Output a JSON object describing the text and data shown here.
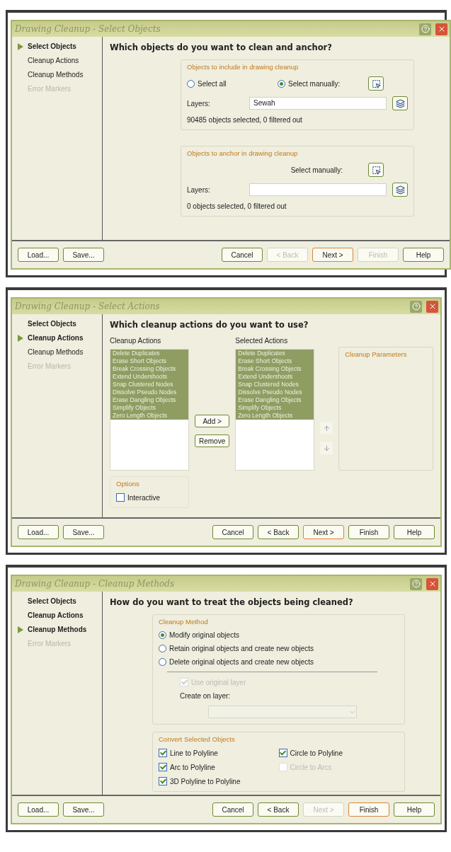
{
  "dialogs": [
    {
      "title": "Drawing Cleanup - Select Objects",
      "steps": [
        {
          "label": "Select Objects",
          "current": true,
          "visited": true,
          "disabled": false
        },
        {
          "label": "Cleanup Actions",
          "current": false,
          "visited": false,
          "disabled": false
        },
        {
          "label": "Cleanup Methods",
          "current": false,
          "visited": false,
          "disabled": false
        },
        {
          "label": "Error Markers",
          "current": false,
          "visited": false,
          "disabled": true
        }
      ],
      "heading": "Which objects do you want to clean and anchor?",
      "page": {
        "kind": "select",
        "groups": [
          {
            "legend": "Objects to include in drawing cleanup",
            "radios": [
              {
                "label": "Select all",
                "selected": false
              },
              {
                "label": "Select manually:",
                "selected": true
              }
            ],
            "layers_label": "Layers:",
            "layers_value": "Sewah",
            "summary": "90485 objects selected, 0 filtered out"
          },
          {
            "legend": "Objects to anchor in drawing cleanup",
            "manual_label": "Select manually:",
            "layers_label": "Layers:",
            "summary": "0 objects selected, 0 filtered out"
          }
        ]
      },
      "buttons": [
        {
          "label": "Load...",
          "disabled": false,
          "default": false
        },
        {
          "label": "Save...",
          "disabled": false,
          "default": false
        },
        {
          "label": "Cancel",
          "disabled": false,
          "default": false
        },
        {
          "label": "< Back",
          "disabled": true,
          "default": false
        },
        {
          "label": "Next >",
          "disabled": false,
          "default": true
        },
        {
          "label": "Finish",
          "disabled": true,
          "default": false
        },
        {
          "label": "Help",
          "disabled": false,
          "default": false
        }
      ]
    },
    {
      "title": "Drawing Cleanup - Select Actions",
      "steps": [
        {
          "label": "Select Objects",
          "current": false,
          "visited": true,
          "disabled": false
        },
        {
          "label": "Cleanup Actions",
          "current": true,
          "visited": true,
          "disabled": false
        },
        {
          "label": "Cleanup Methods",
          "current": false,
          "visited": false,
          "disabled": false
        },
        {
          "label": "Error Markers",
          "current": false,
          "visited": false,
          "disabled": true
        }
      ],
      "heading": "Which cleanup actions do you want to use?",
      "page": {
        "kind": "actions",
        "available": {
          "label": "Cleanup Actions",
          "items": [
            {
              "label": "Delete Duplicates",
              "selected": true
            },
            {
              "label": "Erase Short Objects",
              "selected": true
            },
            {
              "label": "Break Crossing Objects",
              "selected": true
            },
            {
              "label": "Extend Undershoots",
              "selected": true
            },
            {
              "label": "Snap Clustered Nodes",
              "selected": true
            },
            {
              "label": "Dissolve Pseudo Nodes",
              "selected": true
            },
            {
              "label": "Erase Dangling Objects",
              "selected": true
            },
            {
              "label": "Simplify Objects",
              "selected": true
            },
            {
              "label": "Zero Length Objects",
              "selected": true
            }
          ]
        },
        "add": "Add >",
        "remove": "Remove",
        "chosen": {
          "label": "Selected Actions",
          "items": [
            {
              "label": "Delete Duplicates",
              "selected": true
            },
            {
              "label": "Erase Short Objects",
              "selected": true
            },
            {
              "label": "Break Crossing Objects",
              "selected": true
            },
            {
              "label": "Extend Undershoots",
              "selected": true
            },
            {
              "label": "Snap Clustered Nodes",
              "selected": true
            },
            {
              "label": "Dissolve Pseudo Nodes",
              "selected": true
            },
            {
              "label": "Erase Dangling Objects",
              "selected": true
            },
            {
              "label": "Simplify Objects",
              "selected": true
            },
            {
              "label": "Zero Length Objects",
              "selected": true
            }
          ]
        },
        "parameters_legend": "Cleanup Parameters",
        "options_legend": "Options",
        "interactive": {
          "label": "Interactive",
          "checked": false
        }
      },
      "buttons": [
        {
          "label": "Load...",
          "disabled": false,
          "default": false
        },
        {
          "label": "Save...",
          "disabled": false,
          "default": false
        },
        {
          "label": "Cancel",
          "disabled": false,
          "default": false
        },
        {
          "label": "< Back",
          "disabled": false,
          "default": false
        },
        {
          "label": "Next >",
          "disabled": false,
          "default": true
        },
        {
          "label": "Finish",
          "disabled": false,
          "default": false
        },
        {
          "label": "Help",
          "disabled": false,
          "default": false
        }
      ]
    },
    {
      "title": "Drawing Cleanup - Cleanup Methods",
      "steps": [
        {
          "label": "Select Objects",
          "current": false,
          "visited": true,
          "disabled": false
        },
        {
          "label": "Cleanup Actions",
          "current": false,
          "visited": true,
          "disabled": false
        },
        {
          "label": "Cleanup Methods",
          "current": true,
          "visited": true,
          "disabled": false
        },
        {
          "label": "Error Markers",
          "current": false,
          "visited": false,
          "disabled": true
        }
      ],
      "heading": "How do you want to treat the objects being cleaned?",
      "page": {
        "kind": "methods",
        "method_legend": "Cleanup Method",
        "methods": [
          {
            "label": "Modify original objects",
            "selected": true
          },
          {
            "label": "Retain original objects and create new objects",
            "selected": false
          },
          {
            "label": "Delete original objects and create new objects",
            "selected": false
          }
        ],
        "use_original": {
          "label": "Use original layer",
          "checked": true,
          "disabled": true
        },
        "create_label": "Create on layer:",
        "convert_legend": "Convert Selected Objects",
        "conversions": [
          {
            "label": "Line to Polyline",
            "checked": true,
            "disabled": false
          },
          {
            "label": "Circle to Polyline",
            "checked": true,
            "disabled": false
          },
          {
            "label": "Arc to Polyline",
            "checked": true,
            "disabled": false
          },
          {
            "label": "Circle to Arcs",
            "checked": false,
            "disabled": true
          },
          {
            "label": "3D Polyline to Polyline",
            "checked": true,
            "disabled": false
          }
        ]
      },
      "buttons": [
        {
          "label": "Load...",
          "disabled": false,
          "default": false
        },
        {
          "label": "Save...",
          "disabled": false,
          "default": false
        },
        {
          "label": "Cancel",
          "disabled": false,
          "default": false
        },
        {
          "label": "< Back",
          "disabled": false,
          "default": false
        },
        {
          "label": "Next >",
          "disabled": true,
          "default": false
        },
        {
          "label": "Finish",
          "disabled": false,
          "default": true
        },
        {
          "label": "Help",
          "disabled": false,
          "default": false
        }
      ]
    }
  ]
}
